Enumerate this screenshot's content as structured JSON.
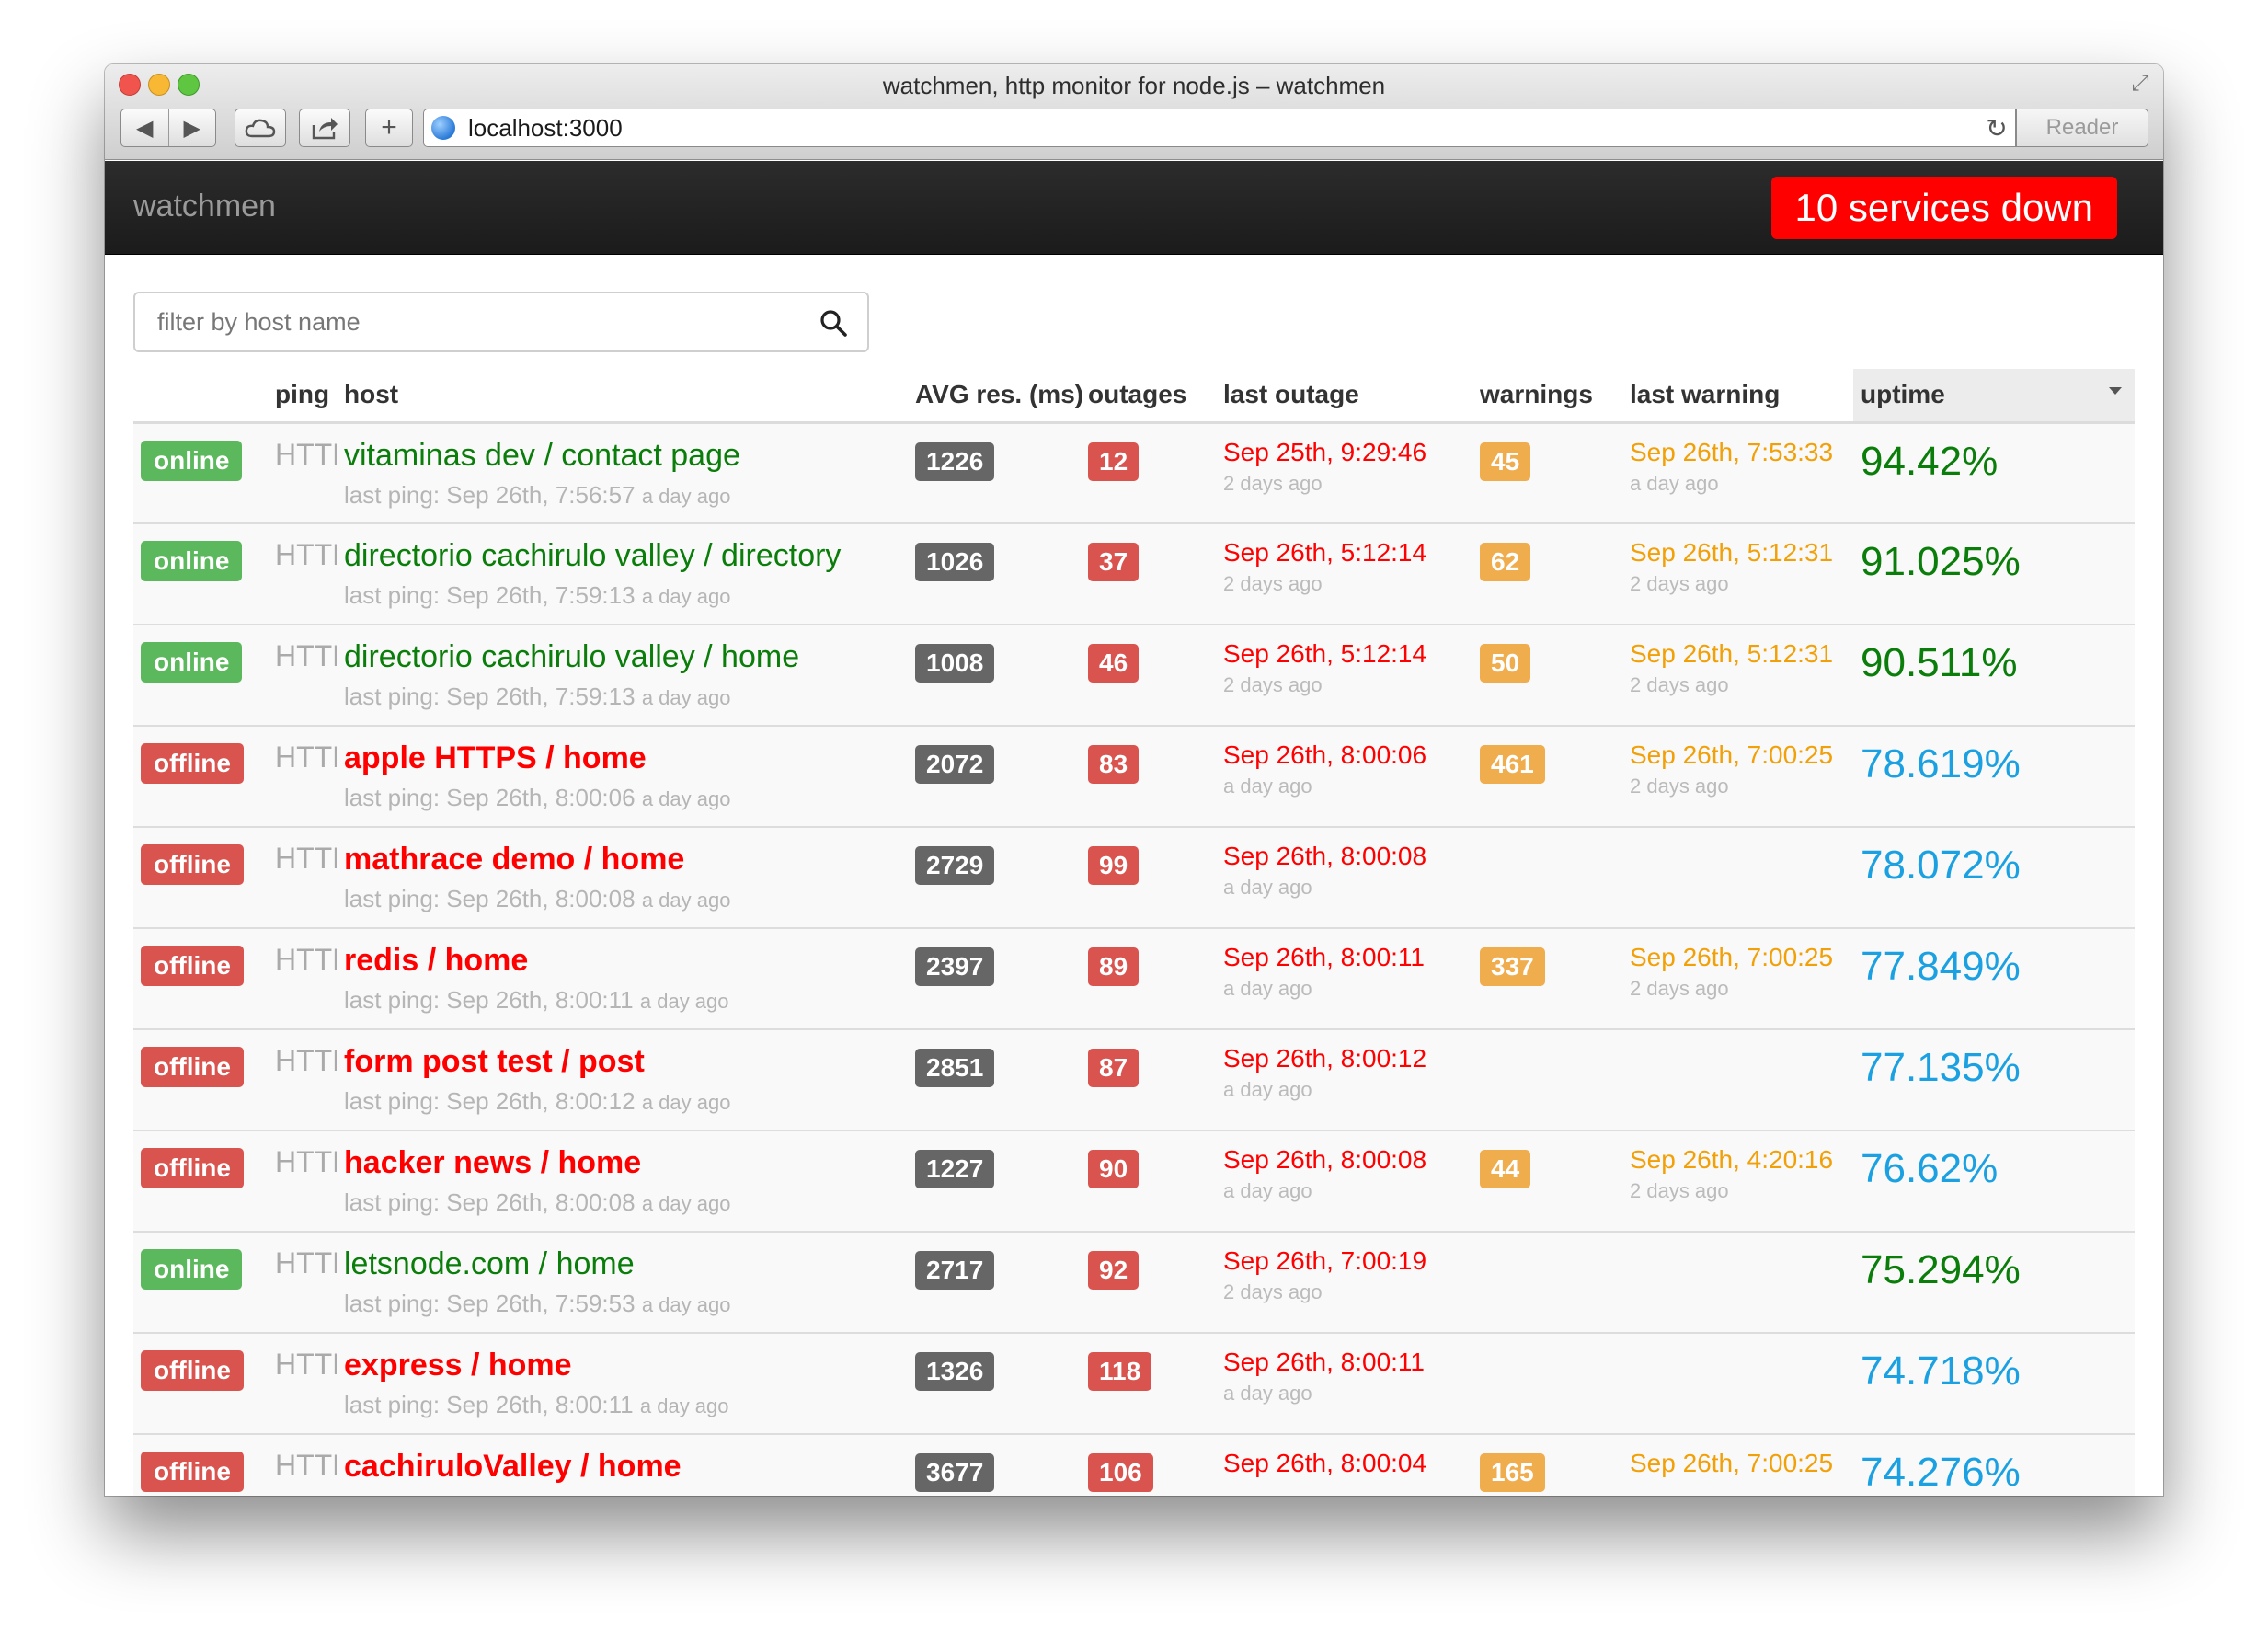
{
  "window": {
    "title": "watchmen, http monitor for node.js – watchmen",
    "url": "localhost:3000",
    "reader_label": "Reader"
  },
  "navbar": {
    "brand": "watchmen",
    "services_down": "10 services down"
  },
  "filter": {
    "placeholder": "filter by host name"
  },
  "columns": {
    "ping": "ping",
    "host": "host",
    "avg": "AVG res. (ms)",
    "outages": "outages",
    "last_outage": "last outage",
    "warnings": "warnings",
    "last_warning": "last warning",
    "uptime": "uptime"
  },
  "rows": [
    {
      "status": "online",
      "ping": "HTTP",
      "host": "vitaminas dev / contact page",
      "last_ping": "last ping: Sep 26th, 7:56:57",
      "last_ping_ago": "a day ago",
      "avg": "1226",
      "outages": "12",
      "last_outage": "Sep 25th, 9:29:46",
      "last_outage_ago": "2 days ago",
      "warnings": "45",
      "last_warning": "Sep 26th, 7:53:33",
      "last_warning_ago": "a day ago",
      "uptime": "94.42%"
    },
    {
      "status": "online",
      "ping": "HTTP",
      "host": "directorio cachirulo valley / directory",
      "last_ping": "last ping: Sep 26th, 7:59:13",
      "last_ping_ago": "a day ago",
      "avg": "1026",
      "outages": "37",
      "last_outage": "Sep 26th, 5:12:14",
      "last_outage_ago": "2 days ago",
      "warnings": "62",
      "last_warning": "Sep 26th, 5:12:31",
      "last_warning_ago": "2 days ago",
      "uptime": "91.025%"
    },
    {
      "status": "online",
      "ping": "HTTP",
      "host": "directorio cachirulo valley / home",
      "last_ping": "last ping: Sep 26th, 7:59:13",
      "last_ping_ago": "a day ago",
      "avg": "1008",
      "outages": "46",
      "last_outage": "Sep 26th, 5:12:14",
      "last_outage_ago": "2 days ago",
      "warnings": "50",
      "last_warning": "Sep 26th, 5:12:31",
      "last_warning_ago": "2 days ago",
      "uptime": "90.511%"
    },
    {
      "status": "offline",
      "ping": "HTTP",
      "host": "apple HTTPS / home",
      "last_ping": "last ping: Sep 26th, 8:00:06",
      "last_ping_ago": "a day ago",
      "avg": "2072",
      "outages": "83",
      "last_outage": "Sep 26th, 8:00:06",
      "last_outage_ago": "a day ago",
      "warnings": "461",
      "last_warning": "Sep 26th, 7:00:25",
      "last_warning_ago": "2 days ago",
      "uptime": "78.619%"
    },
    {
      "status": "offline",
      "ping": "HTTP",
      "host": "mathrace demo / home",
      "last_ping": "last ping: Sep 26th, 8:00:08",
      "last_ping_ago": "a day ago",
      "avg": "2729",
      "outages": "99",
      "last_outage": "Sep 26th, 8:00:08",
      "last_outage_ago": "a day ago",
      "warnings": "",
      "last_warning": "",
      "last_warning_ago": "",
      "uptime": "78.072%"
    },
    {
      "status": "offline",
      "ping": "HTTP",
      "host": "redis / home",
      "last_ping": "last ping: Sep 26th, 8:00:11",
      "last_ping_ago": "a day ago",
      "avg": "2397",
      "outages": "89",
      "last_outage": "Sep 26th, 8:00:11",
      "last_outage_ago": "a day ago",
      "warnings": "337",
      "last_warning": "Sep 26th, 7:00:25",
      "last_warning_ago": "2 days ago",
      "uptime": "77.849%"
    },
    {
      "status": "offline",
      "ping": "HTTP",
      "host": "form post test / post",
      "last_ping": "last ping: Sep 26th, 8:00:12",
      "last_ping_ago": "a day ago",
      "avg": "2851",
      "outages": "87",
      "last_outage": "Sep 26th, 8:00:12",
      "last_outage_ago": "a day ago",
      "warnings": "",
      "last_warning": "",
      "last_warning_ago": "",
      "uptime": "77.135%"
    },
    {
      "status": "offline",
      "ping": "HTTP",
      "host": "hacker news / home",
      "last_ping": "last ping: Sep 26th, 8:00:08",
      "last_ping_ago": "a day ago",
      "avg": "1227",
      "outages": "90",
      "last_outage": "Sep 26th, 8:00:08",
      "last_outage_ago": "a day ago",
      "warnings": "44",
      "last_warning": "Sep 26th, 4:20:16",
      "last_warning_ago": "2 days ago",
      "uptime": "76.62%"
    },
    {
      "status": "online",
      "ping": "HTTP",
      "host": "letsnode.com / home",
      "last_ping": "last ping: Sep 26th, 7:59:53",
      "last_ping_ago": "a day ago",
      "avg": "2717",
      "outages": "92",
      "last_outage": "Sep 26th, 7:00:19",
      "last_outage_ago": "2 days ago",
      "warnings": "",
      "last_warning": "",
      "last_warning_ago": "",
      "uptime": "75.294%"
    },
    {
      "status": "offline",
      "ping": "HTTP",
      "host": "express / home",
      "last_ping": "last ping: Sep 26th, 8:00:11",
      "last_ping_ago": "a day ago",
      "avg": "1326",
      "outages": "118",
      "last_outage": "Sep 26th, 8:00:11",
      "last_outage_ago": "a day ago",
      "warnings": "",
      "last_warning": "",
      "last_warning_ago": "",
      "uptime": "74.718%"
    },
    {
      "status": "offline",
      "ping": "HTTP",
      "host": "cachiruloValley / home",
      "last_ping": "",
      "last_ping_ago": "",
      "avg": "3677",
      "outages": "106",
      "last_outage": "Sep 26th, 8:00:04",
      "last_outage_ago": "",
      "warnings": "165",
      "last_warning": "Sep 26th, 7:00:25",
      "last_warning_ago": "",
      "uptime": "74.276%"
    }
  ],
  "colors": {
    "online": "#5cb85c",
    "offline": "#d9534f",
    "host_online": "#0a7d0a",
    "host_offline": "#ff0000",
    "warning": "#f0ad4e",
    "uptime_blue": "#1ba1e2",
    "down_badge": "#ff0000"
  },
  "icons": {
    "back": "back-arrow-icon",
    "forward": "forward-arrow-icon",
    "cloud": "cloud-icon",
    "share": "share-icon",
    "new_tab": "plus-icon",
    "site": "globe-icon",
    "reload": "reload-icon",
    "search": "search-icon",
    "sort": "sort-desc-icon"
  }
}
